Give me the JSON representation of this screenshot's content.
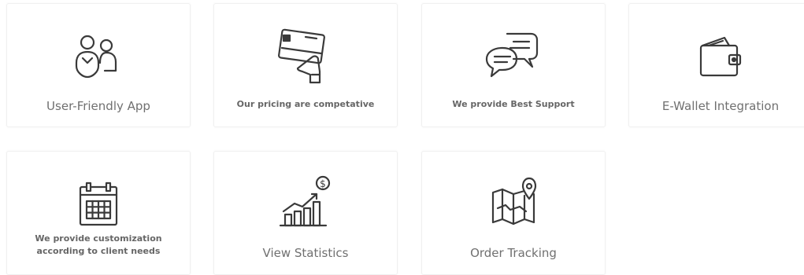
{
  "features": [
    {
      "label": "User-Friendly App",
      "icon": "users-icon"
    },
    {
      "label": "Our pricing are competative",
      "icon": "credit-card-hand-icon"
    },
    {
      "label": "We provide Best Support",
      "icon": "chat-bubbles-icon"
    },
    {
      "label": "E-Wallet Integration",
      "icon": "wallet-icon"
    },
    {
      "label": "We provide customization\naccording to client needs",
      "icon": "calendar-icon"
    },
    {
      "label": "View Statistics",
      "icon": "growth-chart-icon"
    },
    {
      "label": "Order Tracking",
      "icon": "map-pin-icon"
    }
  ],
  "colors": {
    "icon_stroke": "#3a3a3a",
    "label_text": "#6f6f6f",
    "card_border": "#f0f0f0"
  }
}
